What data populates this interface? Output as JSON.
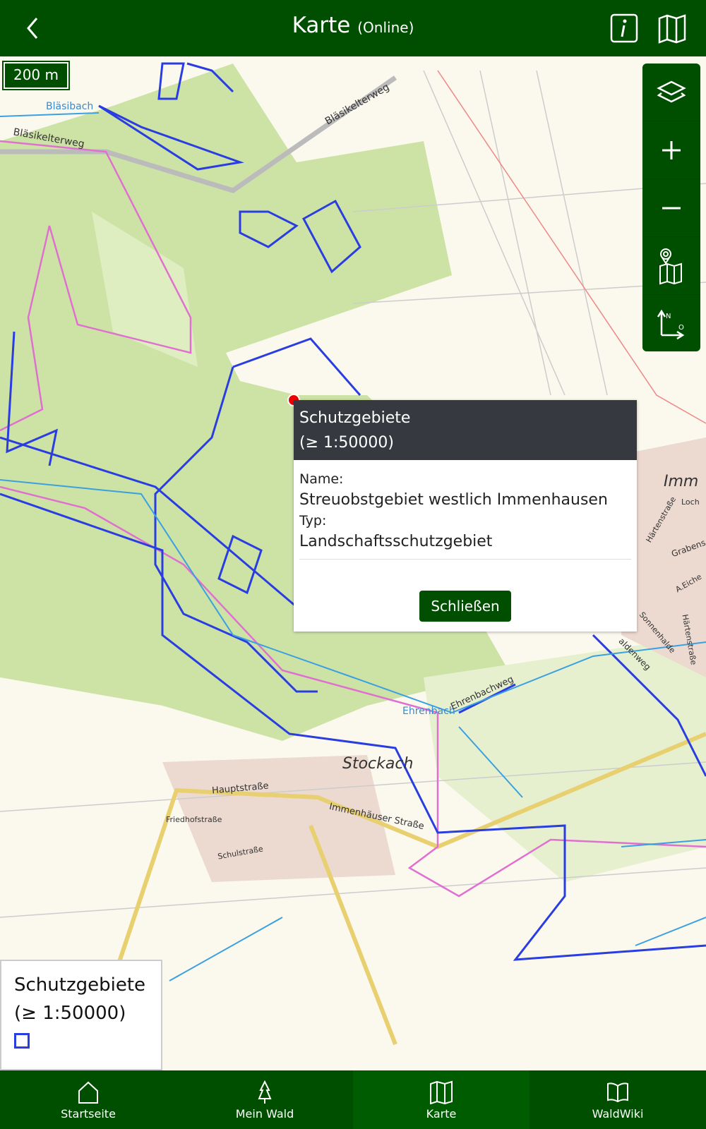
{
  "header": {
    "title": "Karte",
    "subtitle": "(Online)",
    "back_icon": "chevron-left-icon",
    "info_icon": "info-icon",
    "map_icon": "map-icon"
  },
  "map": {
    "scale": "200 m",
    "labels": {
      "blaesibach": "Bläsibach",
      "blaesikelterweg1": "Bläsikelterweg",
      "blaesikelterweg2": "Bläsikelterweg",
      "stockach": "Stockach",
      "hauptstrasse": "Hauptstraße",
      "immenhaeuser": "Immenhäuser Straße",
      "friedhof": "Friedhofstraße",
      "schul": "Schulstraße",
      "ehrenbach": "Ehrenbach",
      "ehrenbachweg": "Ehrenbachweg",
      "haerten": "Härtenstraße",
      "haerten2": "Härtenstraße",
      "sonnenhalde": "Sonnenhalde",
      "imm": "Imm",
      "grabens": "Grabens",
      "aeichen": "A.Eiche",
      "loch": "Loch",
      "waldenweg": "aldenweg"
    },
    "colors": {
      "forest": "#cde3a6",
      "boundary": "#2a3de0",
      "pink": "#e070d0",
      "stream": "#3aa0e0",
      "base": "#fbf9ee"
    }
  },
  "controls": [
    {
      "name": "layers",
      "icon": "layers-icon"
    },
    {
      "name": "zoom-in",
      "icon": "plus-icon"
    },
    {
      "name": "zoom-out",
      "icon": "minus-icon"
    },
    {
      "name": "locate-map",
      "icon": "map-pin-icon"
    },
    {
      "name": "north",
      "icon": "compass-north-icon",
      "n": "N",
      "o": "O"
    }
  ],
  "popup": {
    "title": "Schutzgebiete",
    "scale": "(≥ 1:50000)",
    "name_label": "Name:",
    "name_value": "Streuobstgebiet westlich Immenhausen",
    "type_label": "Typ:",
    "type_value": "Landschaftsschutzgebiet",
    "close": "Schließen"
  },
  "legend": {
    "title": "Schutzgebiete",
    "scale": "(≥ 1:50000)",
    "swatch_color": "#2a3de0"
  },
  "nav": [
    {
      "label": "Startseite",
      "icon": "home-icon"
    },
    {
      "label": "Mein Wald",
      "icon": "tree-icon"
    },
    {
      "label": "Karte",
      "icon": "map-icon",
      "active": true
    },
    {
      "label": "WaldWiki",
      "icon": "book-icon"
    }
  ]
}
